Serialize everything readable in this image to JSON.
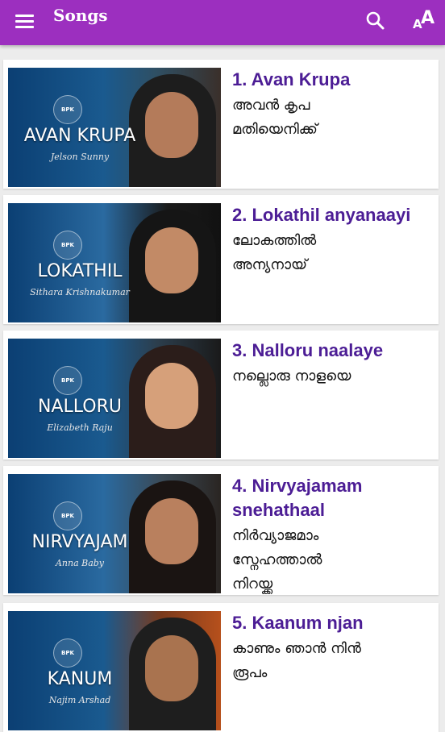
{
  "header": {
    "title": "Songs",
    "icons": {
      "menu": "hamburger-menu-icon",
      "search": "search-icon",
      "font": "font-size-icon"
    },
    "font_label_small": "A",
    "font_label_big": "A"
  },
  "colors": {
    "appbar": "#9c2fbf",
    "title_text": "#4c1d95"
  },
  "songs": [
    {
      "number_title": "1. Avan Krupa",
      "malayalam": "അവൻ കൃപ\nമതിയെനിക്ക്",
      "thumb_title": "AVAN KRUPA",
      "artist": "Jelson Sunny",
      "logo": "BPK"
    },
    {
      "number_title": "2. Lokathil anyanaayi",
      "malayalam": "ലോകത്തിൽ\nഅന്യനായ്",
      "thumb_title": "LOKATHIL",
      "artist": "Sithara Krishnakumar",
      "logo": "BPK"
    },
    {
      "number_title": "3. Nalloru naalaye",
      "malayalam": "നല്ലൊരു നാളയെ",
      "thumb_title": "NALLORU",
      "artist": "Elizabeth Raju",
      "logo": "BPK"
    },
    {
      "number_title": "4. Nirvyajamam snehathaal",
      "malayalam": "നിർവ്യാജമാം\nസ്നേഹത്താൽ\nനിറയ്ക്ക",
      "thumb_title": "NIRVYAJAM",
      "artist": "Anna Baby",
      "logo": "BPK"
    },
    {
      "number_title": "5. Kaanum njan",
      "malayalam": "കാണും ഞാൻ നിൻ\nരൂപം",
      "thumb_title": "KANUM",
      "artist": "Najim Arshad",
      "logo": "BPK"
    }
  ]
}
